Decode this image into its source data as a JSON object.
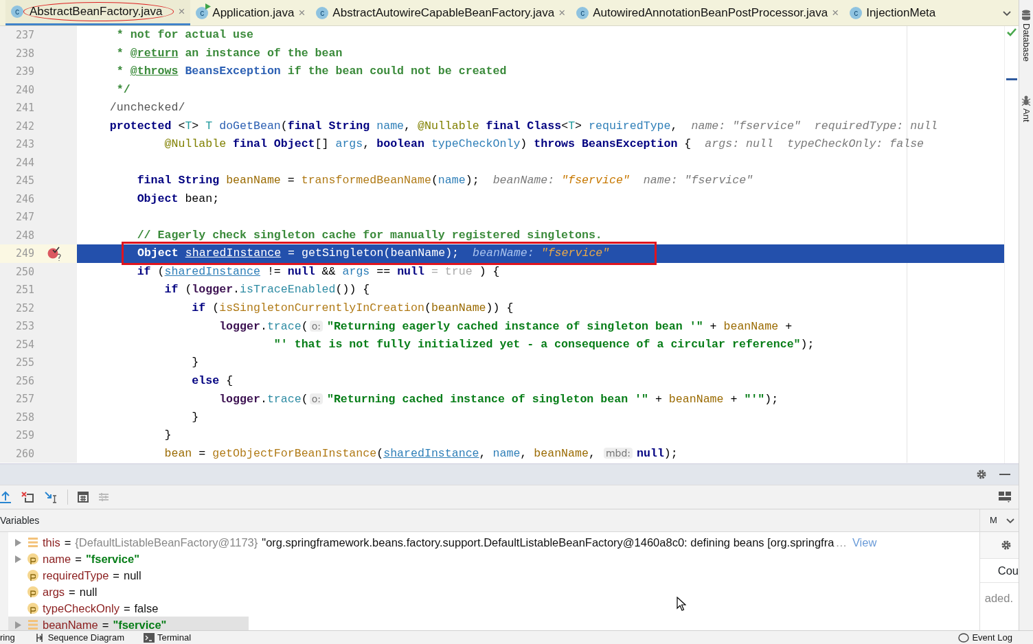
{
  "tabs": [
    {
      "icon_letter": "c",
      "runnable": false,
      "title": "AbstractBeanFactory.java",
      "close": "×",
      "selected": true,
      "marked": true
    },
    {
      "icon_letter": "c",
      "runnable": true,
      "title": "Application.java",
      "close": "×",
      "selected": false,
      "marked": false
    },
    {
      "icon_letter": "c",
      "runnable": false,
      "title": "AbstractAutowireCapableBeanFactory.java",
      "close": "×",
      "selected": false,
      "marked": false
    },
    {
      "icon_letter": "c",
      "runnable": false,
      "title": "AutowiredAnnotationBeanPostProcessor.java",
      "close": "×",
      "selected": false,
      "marked": false
    },
    {
      "icon_letter": "c",
      "runnable": false,
      "title": "InjectionMeta",
      "selected": false,
      "marked": false
    }
  ],
  "editor": {
    "lines": [
      {
        "number": "237",
        "selected": false,
        "breakpoint": false,
        "marked": false,
        "tokens": [
          {
            "kind": "comment",
            "text": "     * not for actual use"
          }
        ]
      },
      {
        "number": "238",
        "selected": false,
        "breakpoint": false,
        "marked": false,
        "tokens": [
          {
            "kind": "comment",
            "text": "     * "
          },
          {
            "kind": "doctag",
            "text": "@return"
          },
          {
            "kind": "comment",
            "text": " an instance of the bean"
          }
        ]
      },
      {
        "number": "239",
        "selected": false,
        "breakpoint": false,
        "marked": false,
        "tokens": [
          {
            "kind": "comment",
            "text": "     * "
          },
          {
            "kind": "doctag",
            "text": "@throws"
          },
          {
            "kind": "doclink",
            "text": " BeansException"
          },
          {
            "kind": "comment",
            "text": " if the bean could not be created"
          }
        ]
      },
      {
        "number": "240",
        "selected": false,
        "breakpoint": false,
        "marked": false,
        "tokens": [
          {
            "kind": "comment",
            "text": "     */"
          }
        ]
      },
      {
        "number": "241",
        "selected": false,
        "breakpoint": false,
        "marked": false,
        "tokens": [
          {
            "kind": "muted",
            "text": "    /unchecked/"
          }
        ]
      },
      {
        "number": "242",
        "selected": false,
        "breakpoint": false,
        "marked": false,
        "tokens": [
          {
            "kind": "kw",
            "text": "    protected"
          },
          {
            "kind": "plain",
            "text": " <"
          },
          {
            "kind": "tparam",
            "text": "T"
          },
          {
            "kind": "plain",
            "text": "> "
          },
          {
            "kind": "tparam",
            "text": "T "
          },
          {
            "kind": "decl",
            "text": "doGetBean"
          },
          {
            "kind": "plain",
            "text": "("
          },
          {
            "kind": "kw",
            "text": "final "
          },
          {
            "kind": "kw",
            "text": "String "
          },
          {
            "kind": "param",
            "text": "name"
          },
          {
            "kind": "plain",
            "text": ", "
          },
          {
            "kind": "annot",
            "text": "@Nullable "
          },
          {
            "kind": "kw",
            "text": "final "
          },
          {
            "kind": "kw",
            "text": "Class"
          },
          {
            "kind": "plain",
            "text": "<"
          },
          {
            "kind": "tparam",
            "text": "T"
          },
          {
            "kind": "plain",
            "text": "> "
          },
          {
            "kind": "param",
            "text": "requiredType"
          },
          {
            "kind": "plain",
            "text": ","
          },
          {
            "kind": "hint",
            "text": "name: \"fservice\""
          },
          {
            "kind": "hint",
            "text": "requiredType: null"
          }
        ]
      },
      {
        "number": "243",
        "selected": false,
        "breakpoint": false,
        "marked": false,
        "tokens": [
          {
            "kind": "annot",
            "text": "            @Nullable "
          },
          {
            "kind": "kw",
            "text": "final "
          },
          {
            "kind": "kw",
            "text": "Object"
          },
          {
            "kind": "plain",
            "text": "[] "
          },
          {
            "kind": "param",
            "text": "args"
          },
          {
            "kind": "plain",
            "text": ", "
          },
          {
            "kind": "kw",
            "text": "boolean "
          },
          {
            "kind": "param",
            "text": "typeCheckOnly"
          },
          {
            "kind": "plain",
            "text": ") "
          },
          {
            "kind": "kw",
            "text": "throws "
          },
          {
            "kind": "type",
            "text": "BeansException"
          },
          {
            "kind": "plain",
            "text": " {"
          },
          {
            "kind": "hint",
            "text": "args: null"
          },
          {
            "kind": "hint",
            "text": "typeCheckOnly: false"
          }
        ]
      },
      {
        "number": "244",
        "selected": false,
        "breakpoint": false,
        "marked": false
      },
      {
        "number": "245",
        "selected": false,
        "breakpoint": false,
        "marked": false,
        "tokens": [
          {
            "kind": "kw",
            "text": "        final "
          },
          {
            "kind": "kw",
            "text": "String "
          },
          {
            "kind": "local",
            "text": "beanName"
          },
          {
            "kind": "plain",
            "text": " = "
          },
          {
            "kind": "method",
            "text": "transformedBeanName"
          },
          {
            "kind": "plain",
            "text": "("
          },
          {
            "kind": "param",
            "text": "name"
          },
          {
            "kind": "plain",
            "text": ");"
          },
          {
            "kind": "hint",
            "text": "beanName:"
          },
          {
            "kind": "hintvalue",
            "text": "\"fservice\""
          },
          {
            "kind": "hint",
            "text": "name: \"fservice\""
          }
        ]
      },
      {
        "number": "246",
        "selected": false,
        "breakpoint": false,
        "marked": false,
        "tokens": [
          {
            "kind": "kw",
            "text": "        Object"
          },
          {
            "kind": "plain",
            "text": " bean;"
          }
        ]
      },
      {
        "number": "247",
        "selected": false,
        "breakpoint": false,
        "marked": false
      },
      {
        "number": "248",
        "selected": false,
        "breakpoint": false,
        "marked": false,
        "tokens": [
          {
            "kind": "comment",
            "text": "        // Eagerly check singleton cache for manually registered singletons."
          }
        ]
      },
      {
        "number": "249",
        "selected": true,
        "breakpoint": true,
        "marked": true,
        "tokens": [
          {
            "kind": "kw",
            "text": "Object "
          },
          {
            "kind": "localu",
            "text": "sharedInstance"
          },
          {
            "kind": "plain",
            "text": " = "
          },
          {
            "kind": "method",
            "text": "getSingleton"
          },
          {
            "kind": "plain",
            "text": "("
          },
          {
            "kind": "local",
            "text": "beanName"
          },
          {
            "kind": "plain",
            "text": ");"
          },
          {
            "kind": "hint",
            "text": "beanName:"
          },
          {
            "kind": "hintvalue",
            "text": "\"fservice\""
          }
        ]
      },
      {
        "number": "250",
        "selected": false,
        "breakpoint": false,
        "marked": false,
        "tokens": [
          {
            "kind": "kw",
            "text": "        if"
          },
          {
            "kind": "plain",
            "text": " ("
          },
          {
            "kind": "localu",
            "text": "sharedInstance"
          },
          {
            "kind": "plain",
            "text": " != "
          },
          {
            "kind": "kw",
            "text": "null"
          },
          {
            "kind": "plain",
            "text": " && "
          },
          {
            "kind": "param",
            "text": "args"
          },
          {
            "kind": "plain",
            "text": " == "
          },
          {
            "kind": "kw",
            "text": "null"
          },
          {
            "kind": "inlinehint",
            "text": " = true "
          },
          {
            "kind": "plain",
            "text": ") {"
          }
        ]
      },
      {
        "number": "251",
        "selected": false,
        "breakpoint": false,
        "marked": false,
        "tokens": [
          {
            "kind": "kw",
            "text": "            if"
          },
          {
            "kind": "plain",
            "text": " ("
          },
          {
            "kind": "field",
            "text": "logger"
          },
          {
            "kind": "plain",
            "text": "."
          },
          {
            "kind": "call",
            "text": "isTraceEnabled"
          },
          {
            "kind": "plain",
            "text": "()) {"
          }
        ]
      },
      {
        "number": "252",
        "selected": false,
        "breakpoint": false,
        "marked": false,
        "tokens": [
          {
            "kind": "kw",
            "text": "                if"
          },
          {
            "kind": "plain",
            "text": " ("
          },
          {
            "kind": "method",
            "text": "isSingletonCurrentlyInCreation"
          },
          {
            "kind": "plain",
            "text": "("
          },
          {
            "kind": "local",
            "text": "beanName"
          },
          {
            "kind": "plain",
            "text": ")) {"
          }
        ]
      },
      {
        "number": "253",
        "selected": false,
        "breakpoint": false,
        "marked": false,
        "tokens": [
          {
            "kind": "field",
            "text": "                    logger"
          },
          {
            "kind": "plain",
            "text": "."
          },
          {
            "kind": "call",
            "text": "trace"
          },
          {
            "kind": "plain",
            "text": "("
          },
          {
            "kind": "paramhint",
            "text": "o:"
          },
          {
            "kind": "string",
            "text": "\"Returning eagerly cached instance of singleton bean '\""
          },
          {
            "kind": "plain",
            "text": " + "
          },
          {
            "kind": "local",
            "text": "beanName"
          },
          {
            "kind": "plain",
            "text": " +"
          }
        ]
      },
      {
        "number": "254",
        "selected": false,
        "breakpoint": false,
        "marked": false,
        "tokens": [
          {
            "kind": "string",
            "text": "                            \"' that is not fully initialized yet - a consequence of a circular reference\""
          },
          {
            "kind": "plain",
            "text": ");"
          }
        ]
      },
      {
        "number": "255",
        "selected": false,
        "breakpoint": false,
        "marked": false,
        "tokens": [
          {
            "kind": "plain",
            "text": "                }"
          }
        ]
      },
      {
        "number": "256",
        "selected": false,
        "breakpoint": false,
        "marked": false,
        "tokens": [
          {
            "kind": "kw",
            "text": "                else"
          },
          {
            "kind": "plain",
            "text": " {"
          }
        ]
      },
      {
        "number": "257",
        "selected": false,
        "breakpoint": false,
        "marked": false,
        "tokens": [
          {
            "kind": "field",
            "text": "                    logger"
          },
          {
            "kind": "plain",
            "text": "."
          },
          {
            "kind": "call",
            "text": "trace"
          },
          {
            "kind": "plain",
            "text": "("
          },
          {
            "kind": "paramhint",
            "text": "o:"
          },
          {
            "kind": "string",
            "text": "\"Returning cached instance of singleton bean '\""
          },
          {
            "kind": "plain",
            "text": " + "
          },
          {
            "kind": "local",
            "text": "beanName"
          },
          {
            "kind": "plain",
            "text": " + "
          },
          {
            "kind": "string",
            "text": "\"'\""
          },
          {
            "kind": "plain",
            "text": ");"
          }
        ]
      },
      {
        "number": "258",
        "selected": false,
        "breakpoint": false,
        "marked": false,
        "tokens": [
          {
            "kind": "plain",
            "text": "                }"
          }
        ]
      },
      {
        "number": "259",
        "selected": false,
        "breakpoint": false,
        "marked": false,
        "tokens": [
          {
            "kind": "plain",
            "text": "            }"
          }
        ]
      },
      {
        "number": "260",
        "selected": false,
        "breakpoint": false,
        "marked": false,
        "tokens": [
          {
            "kind": "local",
            "text": "            bean"
          },
          {
            "kind": "plain",
            "text": " = "
          },
          {
            "kind": "method",
            "text": "getObjectForBeanInstance"
          },
          {
            "kind": "plain",
            "text": "("
          },
          {
            "kind": "localu",
            "text": "sharedInstance"
          },
          {
            "kind": "plain",
            "text": ", "
          },
          {
            "kind": "param",
            "text": "name"
          },
          {
            "kind": "plain",
            "text": ", "
          },
          {
            "kind": "local",
            "text": "beanName"
          },
          {
            "kind": "plain",
            "text": ", "
          },
          {
            "kind": "paramhint",
            "text": "mbd:"
          },
          {
            "kind": "kw",
            "text": "null"
          },
          {
            "kind": "plain",
            "text": ");"
          }
        ]
      }
    ]
  },
  "debugger": {
    "variables_label": "Variables",
    "side_label": "M",
    "variables": [
      {
        "expandable": true,
        "kind": "field",
        "name": "this",
        "selected": false,
        "tokens": [
          {
            "kind": "op",
            "text": "="
          },
          {
            "kind": "ref",
            "text": "{DefaultListableBeanFactory@1173}"
          },
          {
            "kind": "text",
            "text": "\"org.springframework.beans.factory.support.DefaultListableBeanFactory@1460a8c0: defining beans [org.springfra"
          },
          {
            "kind": "more",
            "text": "…"
          },
          {
            "kind": "link",
            "text": "View"
          }
        ]
      },
      {
        "expandable": true,
        "kind": "param",
        "name": "name",
        "selected": false,
        "tokens": [
          {
            "kind": "op",
            "text": "="
          },
          {
            "kind": "str",
            "text": "\"fservice\""
          }
        ]
      },
      {
        "expandable": false,
        "kind": "param",
        "name": "requiredType",
        "selected": false,
        "tokens": [
          {
            "kind": "op",
            "text": "="
          },
          {
            "kind": "text",
            "text": "null"
          }
        ]
      },
      {
        "expandable": false,
        "kind": "param",
        "name": "args",
        "selected": false,
        "tokens": [
          {
            "kind": "op",
            "text": "="
          },
          {
            "kind": "text",
            "text": "null"
          }
        ]
      },
      {
        "expandable": false,
        "kind": "param",
        "name": "typeCheckOnly",
        "selected": false,
        "tokens": [
          {
            "kind": "op",
            "text": "="
          },
          {
            "kind": "text",
            "text": "false"
          }
        ]
      },
      {
        "expandable": true,
        "kind": "field",
        "name": "beanName",
        "selected": true,
        "tokens": [
          {
            "kind": "op",
            "text": "="
          },
          {
            "kind": "str",
            "text": "\"fservice\""
          }
        ]
      }
    ],
    "side_texts": [
      "Cou",
      "aded."
    ],
    "mouse_pointer": true
  },
  "tool_windows": [
    {
      "kind": "database",
      "label": "Database"
    },
    {
      "kind": "ant",
      "label": "Ant"
    }
  ],
  "status_bar": {
    "left": [
      {
        "kind": "plain",
        "label": "ring"
      },
      {
        "kind": "sequence",
        "label": "Sequence Diagram"
      },
      {
        "kind": "terminal",
        "label": "Terminal"
      }
    ],
    "right": [
      {
        "kind": "eventlog",
        "label": "Event Log"
      }
    ]
  }
}
